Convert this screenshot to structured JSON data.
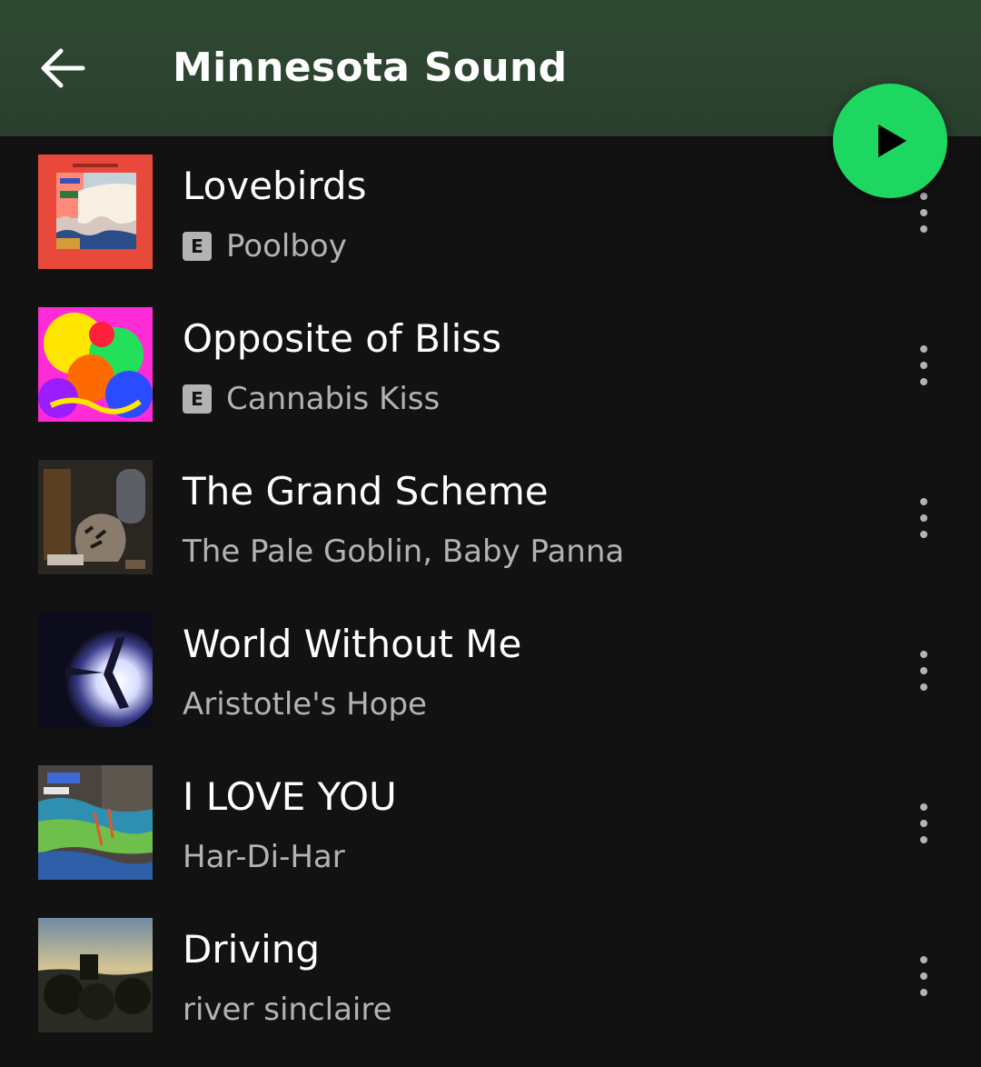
{
  "header": {
    "title": "Minnesota Sound",
    "back_icon": "arrow-left-icon",
    "play_icon": "play-icon",
    "accent_color": "#1ed760",
    "header_color": "#2f4a33"
  },
  "tracks": [
    {
      "title": "Lovebirds",
      "artist": "Poolboy",
      "explicit": true,
      "explicit_label": "E"
    },
    {
      "title": "Opposite of Bliss",
      "artist": "Cannabis Kiss",
      "explicit": true,
      "explicit_label": "E"
    },
    {
      "title": "The Grand Scheme",
      "artist": "The Pale Goblin, Baby Panna",
      "explicit": false
    },
    {
      "title": "World Without Me",
      "artist": "Aristotle's Hope",
      "explicit": false
    },
    {
      "title": "I LOVE YOU",
      "artist": "Har-Di-Har",
      "explicit": false
    },
    {
      "title": "Driving",
      "artist": "river sinclaire",
      "explicit": false
    }
  ]
}
